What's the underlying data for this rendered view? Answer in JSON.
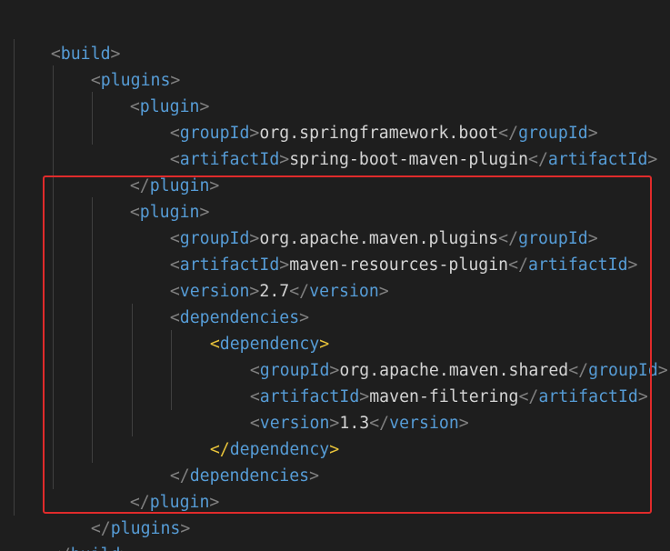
{
  "code_lines": [
    {
      "tag": "build",
      "open": true,
      "text": ""
    },
    {
      "tag": "plugins",
      "open": true,
      "text": ""
    },
    {
      "tag": "plugin",
      "open": true,
      "text": ""
    },
    {
      "tag": "groupId",
      "text": "org.springframework.boot"
    },
    {
      "tag": "artifactId",
      "text": "spring-boot-maven-plugin"
    },
    {
      "tag": "plugin",
      "close": true
    },
    {
      "tag": "plugin",
      "open": true
    },
    {
      "tag": "groupId",
      "text": "org.apache.maven.plugins"
    },
    {
      "tag": "artifactId",
      "text": "maven-resources-plugin"
    },
    {
      "tag": "version",
      "text": "2.7"
    },
    {
      "tag": "dependencies",
      "open": true
    },
    {
      "tag": "dependency",
      "open": true
    },
    {
      "tag": "groupId",
      "text": "org.apache.maven.shared"
    },
    {
      "tag": "artifactId",
      "text": "maven-filtering"
    },
    {
      "tag": "version",
      "text": "1.3"
    },
    {
      "tag": "dependency",
      "close": true
    },
    {
      "tag": "dependencies",
      "close": true
    },
    {
      "tag": "plugin",
      "close": true
    },
    {
      "tag": "plugins",
      "close": true
    },
    {
      "tag": "build",
      "close": true
    }
  ],
  "colors": {
    "background": "#1e1e1e",
    "tag_blue": "#569cd6",
    "tag_gold": "#e8c33a",
    "bracket": "#808080",
    "text": "#d4d4d4",
    "highlight_border": "#e02b2b"
  }
}
